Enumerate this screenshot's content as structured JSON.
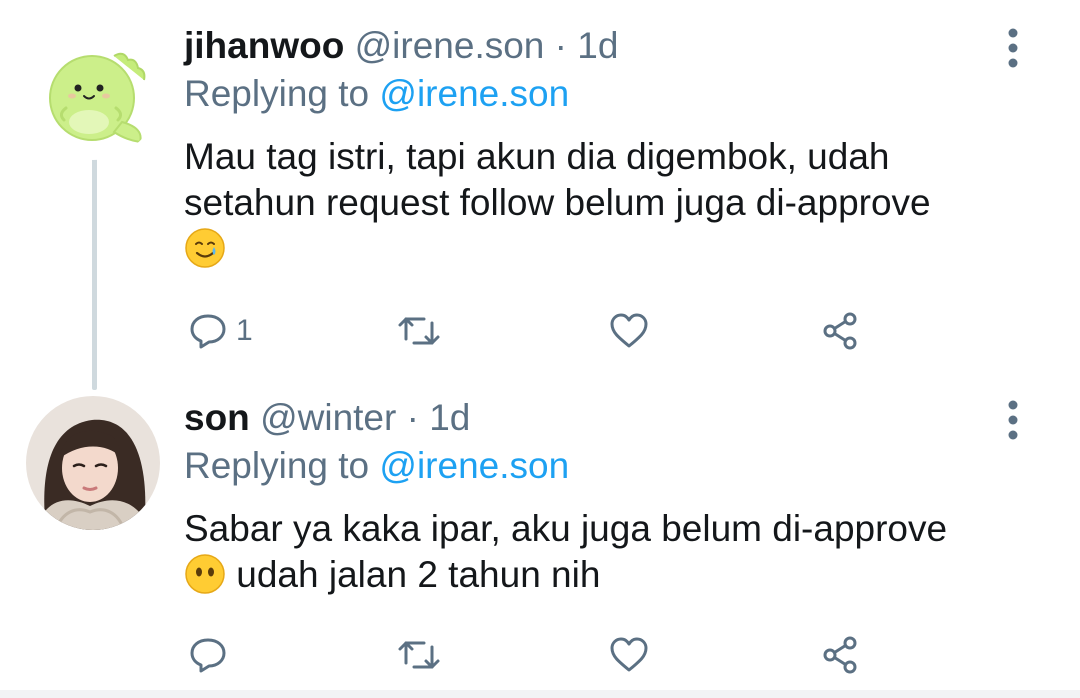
{
  "tweets": [
    {
      "name": "jihanwoo",
      "handle": "@irene.son",
      "separator": "·",
      "time": "1d",
      "replying_prefix": "Replying to",
      "replying_to": "@irene.son",
      "text_line1": "Mau tag istri, tapi akun dia digembok, udah",
      "text_line2": "setahun request follow belum juga di-approve",
      "text_line3": "",
      "emoji": "smiling-face-with-tear",
      "reply_count": "1",
      "avatar": "green-dinosaur-avatar"
    },
    {
      "name": "son",
      "handle": "@winter",
      "separator": "·",
      "time": "1d",
      "replying_prefix": "Replying to",
      "replying_to": "@irene.son",
      "text_line1": "Sabar ya kaka ipar, aku juga belum di-approve",
      "text_line2": "udah jalan 2 tahun nih",
      "emoji": "face-without-mouth",
      "reply_count": "",
      "avatar": "photo-avatar"
    }
  ],
  "colors": {
    "secondary_text": "#5b7083",
    "accent": "#1da1f2",
    "primary_text": "#14171a",
    "thread_line": "#cfd9de"
  }
}
